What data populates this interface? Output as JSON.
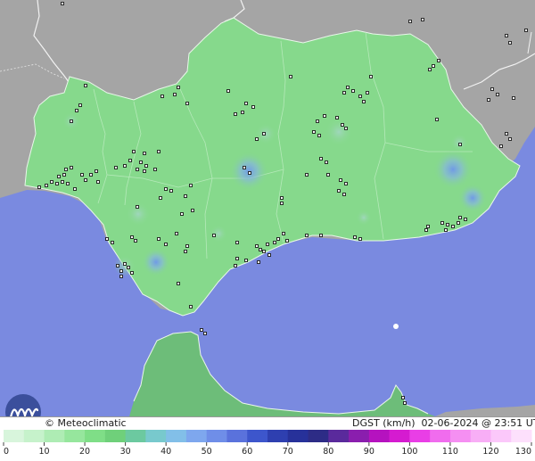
{
  "footer": {
    "brand": "Meteoclimatic",
    "variable": "DGST (km/h)",
    "date": "02-06-2024",
    "time": "23:51",
    "timezone": "UTC"
  },
  "legend": {
    "ticks": [
      "0",
      "10",
      "20",
      "30",
      "40",
      "50",
      "60",
      "70",
      "80",
      "90",
      "100",
      "110",
      "120",
      "130"
    ],
    "colors": [
      "#d8f5dc",
      "#c6f2cb",
      "#aeecb4",
      "#96e69d",
      "#7fde87",
      "#6fd07a",
      "#6cc9a0",
      "#78c9cd",
      "#82bfe8",
      "#7ea7ee",
      "#6f8ee8",
      "#5a72dc",
      "#3d56cc",
      "#2e3fb0",
      "#27319a",
      "#2d2c86",
      "#5a2a9c",
      "#8a1eae",
      "#b512bf",
      "#d51bd0",
      "#e93ee6",
      "#f06cee",
      "#f58ff2",
      "#f8aef6",
      "#fbc8fa",
      "#fde0fc"
    ]
  },
  "map_colors": {
    "sea": "#7a8ae0",
    "land_foreign": "#a5a5a5",
    "andalusia": "#86d98c",
    "morocco": "#6dbd79",
    "gust_spot": "#7aa7e8"
  },
  "stations_shown": true
}
